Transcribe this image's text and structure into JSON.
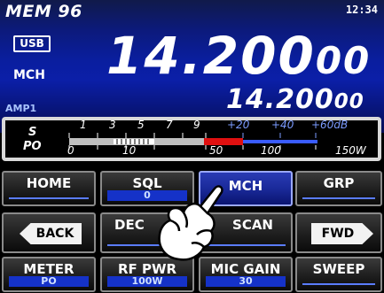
{
  "header": {
    "memory": "MEM 96",
    "clock": "12:34",
    "mode": "USB",
    "channel_mode": "MCH",
    "amp": "AMP1"
  },
  "frequency": {
    "main_big": "14.200",
    "main_small": "00",
    "sub_big": "14.200",
    "sub_small": "00"
  },
  "meter": {
    "s_label": "S",
    "po_label": "PO",
    "s_scale": [
      "1",
      "3",
      "5",
      "7",
      "9",
      "+20",
      "+40",
      "+60dB"
    ],
    "po_scale": [
      "0",
      "10",
      "50",
      "100",
      "150W"
    ],
    "po_level_fraction": 0.44,
    "s_level_fraction": 0.0
  },
  "buttons": {
    "row1": [
      {
        "label": "HOME",
        "value": ""
      },
      {
        "label": "SQL",
        "value": "0"
      },
      {
        "label": "MCH",
        "value": ""
      },
      {
        "label": "GRP",
        "value": ""
      }
    ],
    "row2": [
      {
        "label": "BACK",
        "value": ""
      },
      {
        "label": "DEC",
        "value": ""
      },
      {
        "label": "SCAN",
        "value": ""
      },
      {
        "label": "FWD",
        "value": ""
      }
    ],
    "row3": [
      {
        "label": "METER",
        "value": "PO"
      },
      {
        "label": "RF PWR",
        "value": "100W"
      },
      {
        "label": "MIC GAIN",
        "value": "30"
      },
      {
        "label": "SWEEP",
        "value": ""
      }
    ]
  },
  "colors": {
    "panel_blue": "#0b1fa8",
    "accent_blue": "#1532c8",
    "meter_red": "#e01010"
  }
}
